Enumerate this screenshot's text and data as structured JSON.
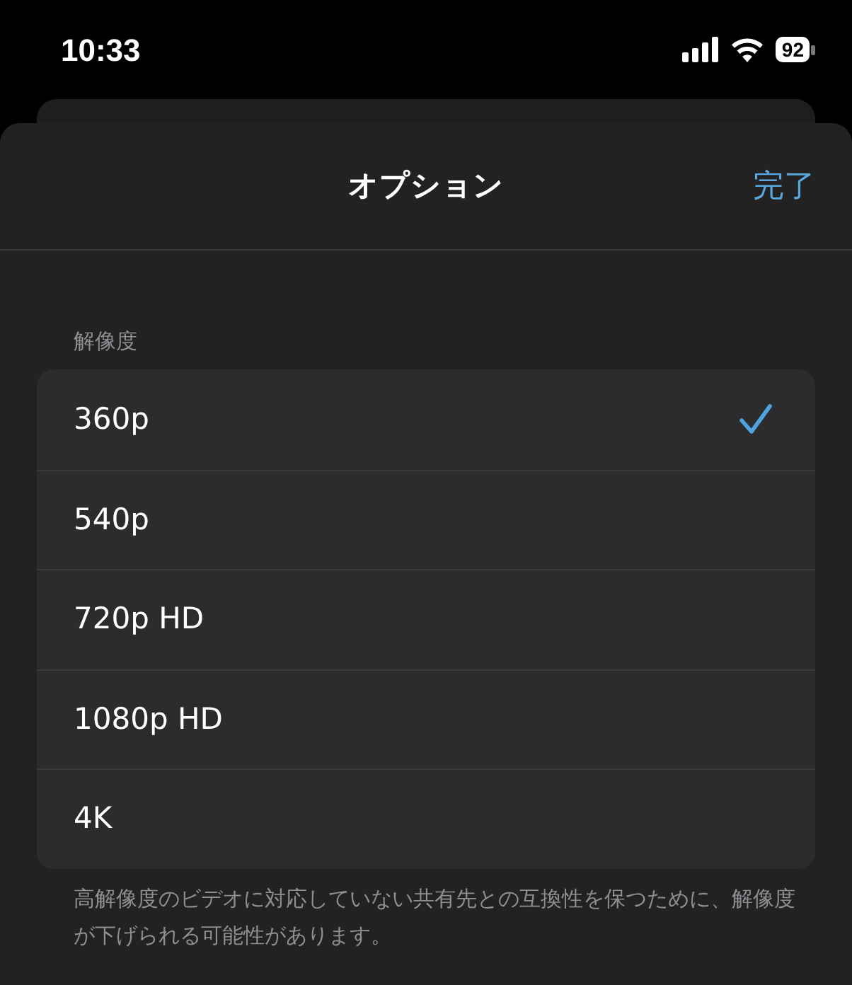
{
  "status_bar": {
    "time": "10:33",
    "battery": "92"
  },
  "header": {
    "title": "オプション",
    "done_button": "完了"
  },
  "resolution": {
    "label": "解像度",
    "options": [
      {
        "label": "360p",
        "selected": true
      },
      {
        "label": "540p",
        "selected": false
      },
      {
        "label": "720p HD",
        "selected": false
      },
      {
        "label": "1080p HD",
        "selected": false
      },
      {
        "label": "4K",
        "selected": false
      }
    ],
    "footer": "高解像度のビデオに対応していない共有先との互換性を保つために、解像度が下げられる可能性があります。"
  }
}
